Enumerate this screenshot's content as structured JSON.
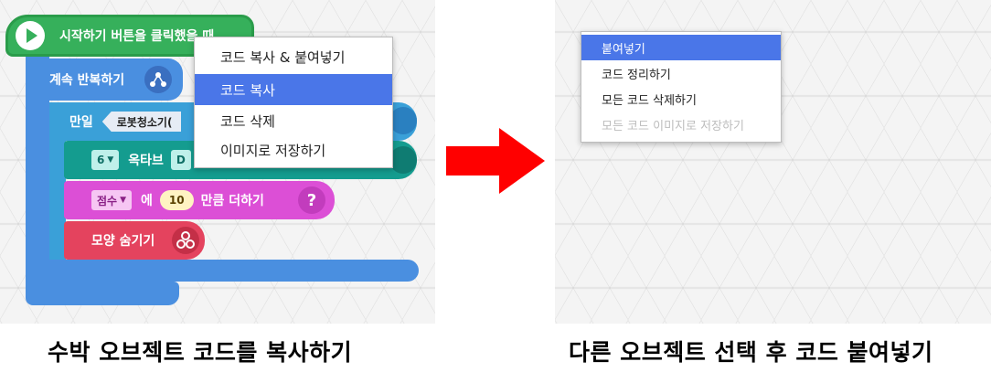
{
  "left": {
    "start_block_label": "시작하기 버튼을 클릭했을 때",
    "repeat_block_label": "계속 반복하기",
    "if_block_label": "만일",
    "if_condition_label": "로봇청소기(",
    "octave_value": "6",
    "octave_label": "옥타브",
    "octave_partial": "D",
    "score_variable": "점수",
    "score_connector": "에",
    "score_amount": "10",
    "score_action": "만큼 더하기",
    "hide_label": "모양 숨기기",
    "context_menu": {
      "items": [
        "코드 복사 & 붙여넣기",
        "코드 복사",
        "코드 삭제",
        "이미지로 저장하기"
      ],
      "highlighted_index": 1
    },
    "caption": "수박 오브젝트 코드를 복사하기"
  },
  "right": {
    "context_menu": {
      "items": [
        "붙여넣기",
        "코드 정리하기",
        "모든 코드 삭제하기",
        "모든 코드 이미지로 저장하기"
      ],
      "highlighted_index": 0,
      "disabled_index": 3
    },
    "caption": "다른 오브젝트 선택 후 코드 붙여넣기"
  },
  "colors": {
    "start_green": "#36b05b",
    "loop_blue": "#4a8fe0",
    "teal": "#149c8f",
    "magenta": "#dc4fd6",
    "red": "#e4435e",
    "menu_highlight": "#4a76e8",
    "arrow_red": "#ff0000"
  }
}
